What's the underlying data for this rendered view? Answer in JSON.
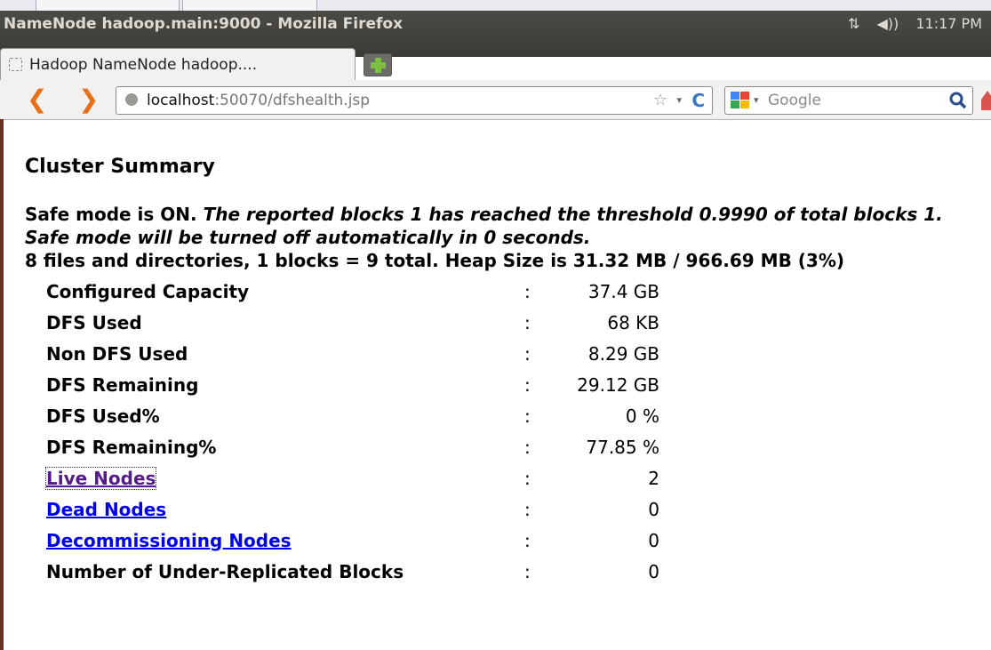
{
  "window": {
    "title": "NameNode hadoop.main:9000 - Mozilla Firefox",
    "clock": "11:17 PM",
    "network_icon": "⇅",
    "volume_icon": "◀))"
  },
  "tab": {
    "label": "Hadoop NameNode hadoop...."
  },
  "navbar": {
    "url_host": "localhost",
    "url_path": ":50070/dfshealth.jsp",
    "search_placeholder": "Google",
    "back_glyph": "❮",
    "forward_glyph": "❯",
    "star_glyph": "☆",
    "dropdown_glyph": "▾",
    "reload_glyph": "C"
  },
  "page": {
    "heading": "Cluster Summary",
    "safe_mode_prefix": "Safe mode is ON. ",
    "safe_mode_detail": "The reported blocks 1 has reached the threshold 0.9990 of total blocks 1. Safe mode will be turned off automatically in 0 seconds.",
    "files_line": "8 files and directories, 1 blocks = 9 total. Heap Size is 31.32 MB / 966.69 MB (3%)",
    "separator": ":",
    "stats": [
      {
        "label": "Configured Capacity",
        "value": "37.4 GB"
      },
      {
        "label": "DFS Used",
        "value": "68 KB"
      },
      {
        "label": "Non DFS Used",
        "value": "8.29 GB"
      },
      {
        "label": "DFS Remaining",
        "value": "29.12 GB"
      },
      {
        "label": "DFS Used%",
        "value": "0 %"
      },
      {
        "label": "DFS Remaining%",
        "value": "77.85 %"
      },
      {
        "label": "Live Nodes",
        "value": "2",
        "link": true
      },
      {
        "label": "Dead Nodes",
        "value": "0",
        "link": true
      },
      {
        "label": "Decommissioning Nodes",
        "value": "0",
        "link": true
      },
      {
        "label": "Number of Under-Replicated Blocks",
        "value": "0"
      }
    ]
  }
}
